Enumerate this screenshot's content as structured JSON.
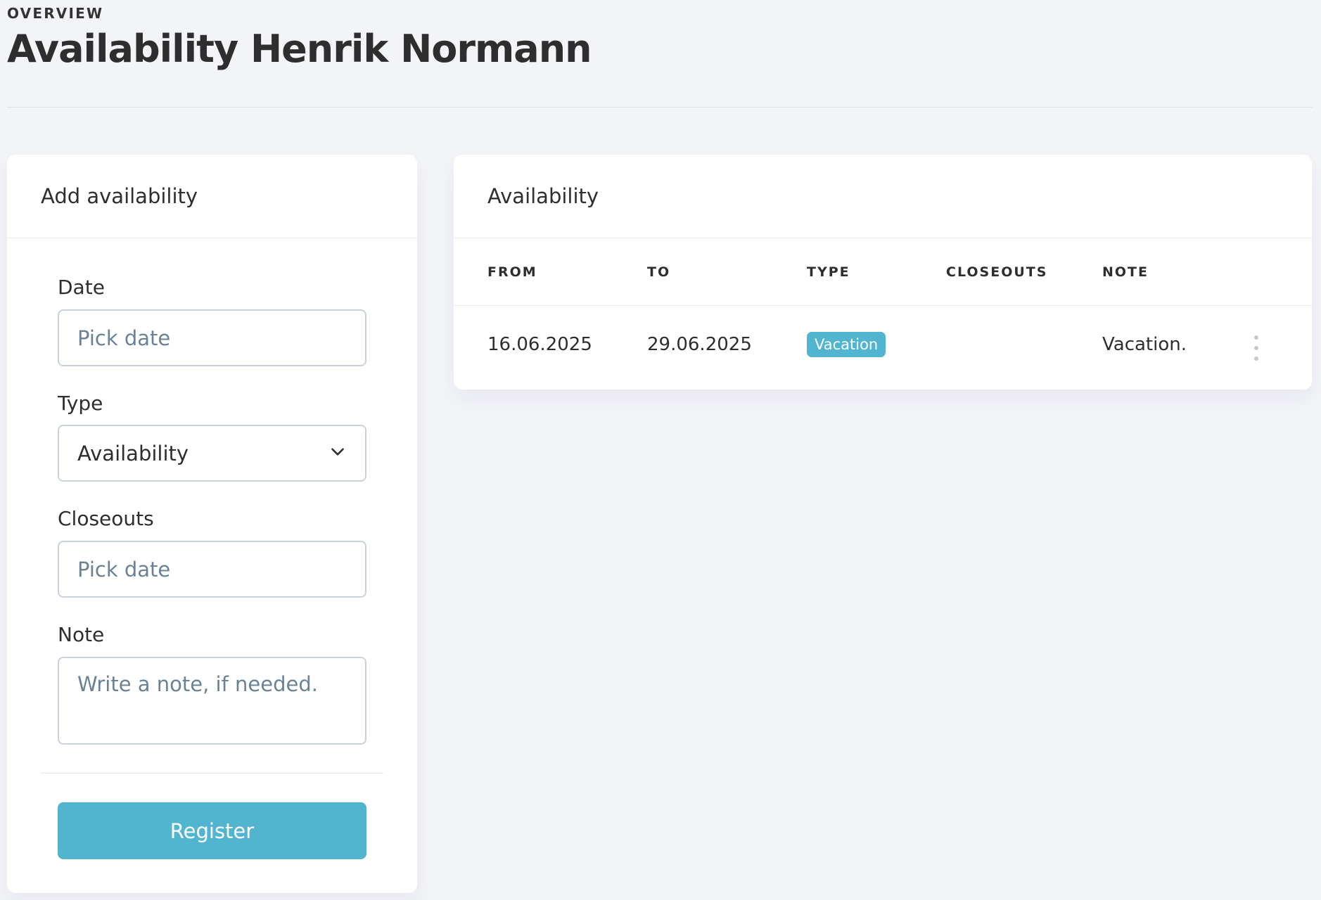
{
  "header": {
    "eyebrow": "OVERVIEW",
    "title": "Availability Henrik Normann"
  },
  "add_form": {
    "title": "Add availability",
    "date": {
      "label": "Date",
      "placeholder": "Pick date"
    },
    "type": {
      "label": "Type",
      "value": "Availability"
    },
    "closeouts": {
      "label": "Closeouts",
      "placeholder": "Pick date"
    },
    "note": {
      "label": "Note",
      "placeholder": "Write a note, if needed."
    },
    "register_label": "Register"
  },
  "availability_table": {
    "title": "Availability",
    "columns": {
      "from": "FROM",
      "to": "TO",
      "type": "TYPE",
      "closeouts": "CLOSEOUTS",
      "note": "NOTE"
    },
    "rows": [
      {
        "from": "16.06.2025",
        "to": "29.06.2025",
        "type": "Vacation",
        "closeouts": "",
        "note": "Vacation."
      }
    ]
  },
  "colors": {
    "accent": "#52b5cf",
    "background": "#f3f4f8",
    "placeholder": "#6a8296"
  }
}
